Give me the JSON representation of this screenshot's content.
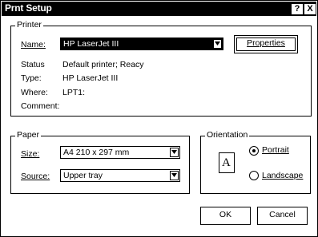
{
  "window": {
    "title": "Prnt Setup",
    "help_label": "?",
    "close_label": "X"
  },
  "printer": {
    "group_label": "Printer",
    "name_label": "Name:",
    "name_value": "HP LaserJet III",
    "properties_label": "Properties",
    "status_label": "Status",
    "status_value": "Default printer; Reacy",
    "type_label": "Type:",
    "type_value": "HP LaserJet III",
    "where_label": "Where:",
    "where_value": "LPT1:",
    "comment_label": "Comment:",
    "comment_value": ""
  },
  "paper": {
    "group_label": "Paper",
    "size_label": "Size:",
    "size_value": "A4 210 x 297 mm",
    "source_label": "Source:",
    "source_value": "Upper tray"
  },
  "orientation": {
    "group_label": "Orientation",
    "icon_letter": "A",
    "portrait_label": "Portrait",
    "landscape_label": "Landscape",
    "selected": "Portrait"
  },
  "buttons": {
    "ok_label": "OK",
    "cancel_label": "Cancel"
  },
  "icons": {
    "dropdown": "chevron-down-icon",
    "page": "portrait-page-icon"
  }
}
